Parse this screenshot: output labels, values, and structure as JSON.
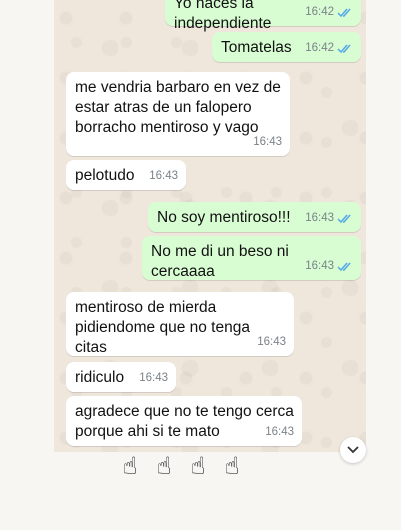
{
  "messages": [
    {
      "side": "out",
      "text": "Yo nacés la independiente",
      "time": "16:42",
      "ticks": true
    },
    {
      "side": "out",
      "text": "Tomatelas",
      "time": "16:42",
      "ticks": true
    },
    {
      "side": "in",
      "text": "me vendria barbaro en vez de\nestar atras de un falopero\nborracho mentiroso y vago",
      "time": "16:43",
      "ticks": false
    },
    {
      "side": "in",
      "text": "pelotudo",
      "time": "16:43",
      "ticks": false
    },
    {
      "side": "out",
      "text": "No soy mentiroso!!!",
      "time": "16:43",
      "ticks": true
    },
    {
      "side": "out",
      "text": "No me di un beso ni cercaaaa",
      "time": "16:43",
      "ticks": true
    },
    {
      "side": "in",
      "text": "mentiroso de mierda\npidiendome que no tenga citas",
      "time": "16:43",
      "ticks": false
    },
    {
      "side": "in",
      "text": "ridiculo",
      "time": "16:43",
      "ticks": false
    },
    {
      "side": "in",
      "text": "agradece que no te tengo cerca\nporque ahi si te mato",
      "time": "16:43",
      "ticks": false
    }
  ],
  "emoji_row": [
    "☝",
    "☝",
    "☝",
    "☝"
  ],
  "icons": {
    "scroll_down": "chevron-down-icon",
    "read_receipt": "double-check-icon"
  },
  "colors": {
    "incoming": "#ffffff",
    "outgoing": "#d9fdd3",
    "chat_bg": "#efe7dc",
    "read_tick": "#53a8e6"
  }
}
